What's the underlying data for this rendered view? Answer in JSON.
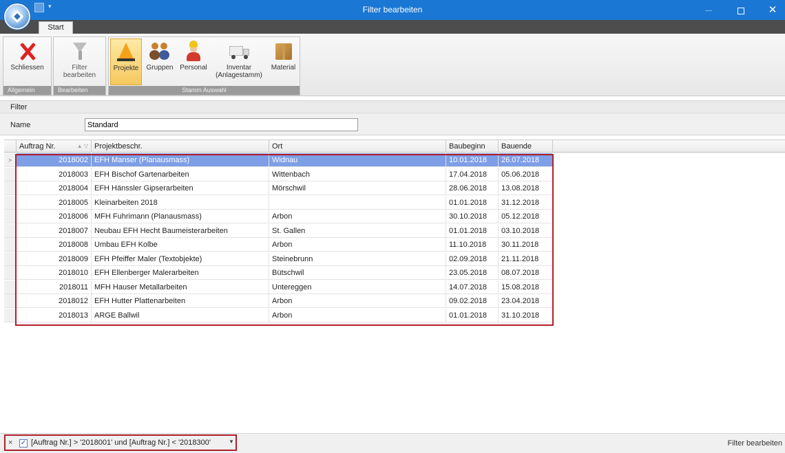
{
  "window": {
    "title": "Filter bearbeiten"
  },
  "ribbon": {
    "tab": "Start",
    "groups": {
      "allgemein": "Allgemein",
      "bearbeiten": "Bearbeiten",
      "stamm": "Stamm Auswahl"
    },
    "buttons": {
      "schliessen": "Schliessen",
      "filter_line1": "Filter",
      "filter_line2": "bearbeiten",
      "projekte": "Projekte",
      "gruppen": "Gruppen",
      "personal": "Personal",
      "inventar_line1": "Inventar",
      "inventar_line2": "(Anlagestamm)",
      "material": "Material"
    },
    "icons": {
      "schliessen": "close-x-icon",
      "filter": "filter-funnel-icon",
      "projekte": "construction-cone-icon",
      "gruppen": "group-people-icon",
      "personal": "worker-person-icon",
      "inventar": "truck-icon",
      "material": "box-icon"
    },
    "active_button": "Projekte"
  },
  "filter": {
    "section_label": "Filter",
    "name_label": "Name",
    "name_value": "Standard"
  },
  "grid": {
    "columns": [
      "Auftrag Nr.",
      "Projektbeschr.",
      "Ort",
      "Baubeginn",
      "Bauende"
    ],
    "rows": [
      [
        "2018002",
        "EFH Manser (Planausmass)",
        "Widnau",
        "10.01.2018",
        "26.07.2018"
      ],
      [
        "2018003",
        "EFH Bischof Gartenarbeiten",
        "Wittenbach",
        "17.04.2018",
        "05.06.2018"
      ],
      [
        "2018004",
        "EFH Hänssler Gipserarbeiten",
        "Mörschwil",
        "28.06.2018",
        "13.08.2018"
      ],
      [
        "2018005",
        "Kleinarbeiten 2018",
        "",
        "01.01.2018",
        "31.12.2018"
      ],
      [
        "2018006",
        "MFH Fuhrimann (Planausmass)",
        "Arbon",
        "30.10.2018",
        "05.12.2018"
      ],
      [
        "2018007",
        "Neubau EFH Hecht Baumeisterarbeiten",
        "St. Gallen",
        "01.01.2018",
        "03.10.2018"
      ],
      [
        "2018008",
        "Umbau EFH Kolbe",
        "Arbon",
        "11.10.2018",
        "30.11.2018"
      ],
      [
        "2018009",
        "EFH Pfeiffer Maler (Textobjekte)",
        "Steinebrunn",
        "02.09.2018",
        "21.11.2018"
      ],
      [
        "2018010",
        "EFH Ellenberger Malerarbeiten",
        "Bütschwil",
        "23.05.2018",
        "08.07.2018"
      ],
      [
        "2018011",
        "MFH Hauser Metallarbeiten",
        "Untereggen",
        "14.07.2018",
        "15.08.2018"
      ],
      [
        "2018012",
        "EFH Hutter Plattenarbeiten",
        "Arbon",
        "09.02.2018",
        "23.04.2018"
      ],
      [
        "2018013",
        "ARGE Ballwil",
        "Arbon",
        "01.01.2018",
        "31.10.2018"
      ]
    ],
    "selected_row": 0,
    "row_indicator": ">"
  },
  "statusbar": {
    "clear_symbol": "×",
    "checked_symbol": "✓",
    "filter_expression": "[Auftrag Nr.] > '2018001' und [Auftrag Nr.] < '2018300'",
    "dropdown_symbol": "▼",
    "edit_filter": "Filter bearbeiten"
  },
  "colors": {
    "titlebar": "#1a78d4",
    "selection": "#7e9ee6",
    "highlight_border": "#b01f2b",
    "active_ribbon_button": "#f6c85f"
  }
}
